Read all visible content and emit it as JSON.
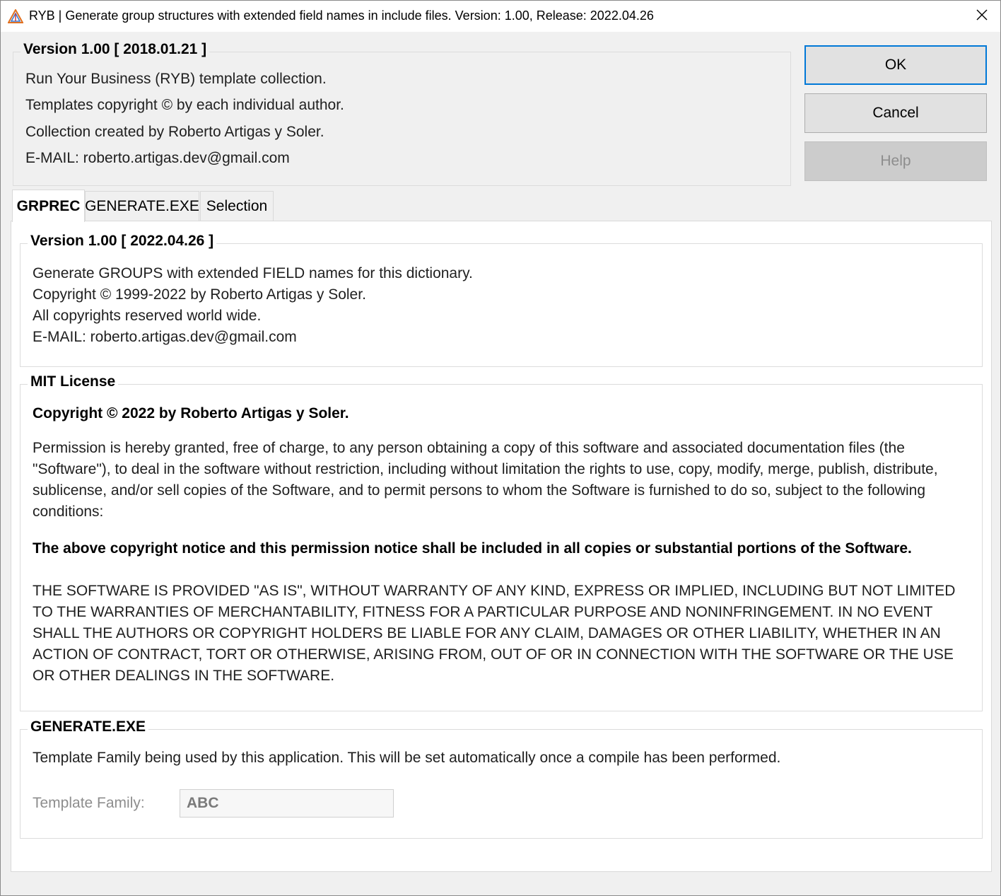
{
  "window": {
    "title": "RYB | Generate group structures with extended field names in include files. Version: 1.00, Release: 2022.04.26"
  },
  "header_group": {
    "legend": "Version 1.00 [ 2018.01.21 ]",
    "lines": [
      "Run Your Business (RYB) template collection.",
      "Templates copyright © by each individual author.",
      "Collection created by Roberto Artigas y Soler.",
      "E-MAIL: roberto.artigas.dev@gmail.com"
    ]
  },
  "buttons": {
    "ok": "OK",
    "cancel": "Cancel",
    "help": "Help"
  },
  "tabs": [
    {
      "label": "GRPREC",
      "active": true
    },
    {
      "label": "GENERATE.EXE",
      "active": false
    },
    {
      "label": "Selection",
      "active": false
    }
  ],
  "version_group": {
    "legend": "Version 1.00 [ 2022.04.26 ]",
    "lines": [
      "Generate GROUPS with extended FIELD names for this dictionary.",
      "Copyright © 1999-2022 by Roberto Artigas y Soler.",
      "All copyrights reserved world wide.",
      "E-MAIL: roberto.artigas.dev@gmail.com"
    ]
  },
  "license_group": {
    "legend": "MIT License",
    "copyright": "Copyright © 2022 by Roberto Artigas y Soler.",
    "permission": "Permission is hereby granted, free of charge, to any person obtaining a copy of this software and associated documentation files (the \"Software\"), to deal in the software without restriction, including without limitation the rights to use, copy, modify, merge, publish, distribute, sublicense, and/or sell copies of the Software, and to permit persons to whom the Software is furnished to do so, subject to the following conditions:",
    "notice": "The above copyright notice and this permission notice shall be included in all copies or substantial portions of the Software.",
    "disclaimer": "THE SOFTWARE IS PROVIDED \"AS IS\", WITHOUT WARRANTY OF ANY KIND, EXPRESS OR IMPLIED, INCLUDING BUT NOT LIMITED TO THE WARRANTIES OF MERCHANTABILITY, FITNESS FOR A PARTICULAR PURPOSE AND NONINFRINGEMENT. IN NO EVENT SHALL THE AUTHORS OR COPYRIGHT HOLDERS BE LIABLE FOR ANY CLAIM, DAMAGES OR OTHER LIABILITY, WHETHER IN AN ACTION OF CONTRACT, TORT OR OTHERWISE, ARISING FROM, OUT OF OR IN CONNECTION WITH THE SOFTWARE OR THE USE OR OTHER DEALINGS IN THE SOFTWARE."
  },
  "generate_group": {
    "legend": "GENERATE.EXE",
    "description": "Template Family being used by this application. This will be set automatically once a compile has been performed.",
    "field_label": "Template Family:",
    "field_value": "ABC"
  },
  "icons": {
    "app": "ryb-triangle-icon",
    "close": "close-icon"
  },
  "colors": {
    "dialog_bg": "#f0f0f0",
    "panel_bg": "#ffffff",
    "focus_border": "#0078d7",
    "disabled_text": "#8d8d8d"
  }
}
